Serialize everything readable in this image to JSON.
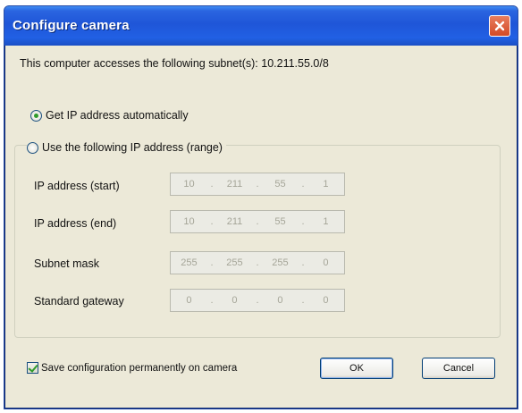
{
  "window": {
    "title": "Configure camera"
  },
  "subnet_text": "This computer accesses the following subnet(s): 10.211.55.0/8",
  "ip_mode": {
    "auto_label": "Get IP address automatically",
    "manual_label": "Use the following IP address (range)",
    "selected": "auto"
  },
  "fields": [
    {
      "label": "IP address (start)",
      "octets": [
        "10",
        "211",
        "55",
        "1"
      ]
    },
    {
      "label": "IP address (end)",
      "octets": [
        "10",
        "211",
        "55",
        "1"
      ]
    },
    {
      "label": "Subnet mask",
      "octets": [
        "255",
        "255",
        "255",
        "0"
      ]
    },
    {
      "label": "Standard gateway",
      "octets": [
        "0",
        "0",
        "0",
        "0"
      ]
    }
  ],
  "save_permanently": {
    "label": "Save configuration permanently on camera",
    "checked": true
  },
  "buttons": {
    "ok": "OK",
    "cancel": "Cancel"
  }
}
